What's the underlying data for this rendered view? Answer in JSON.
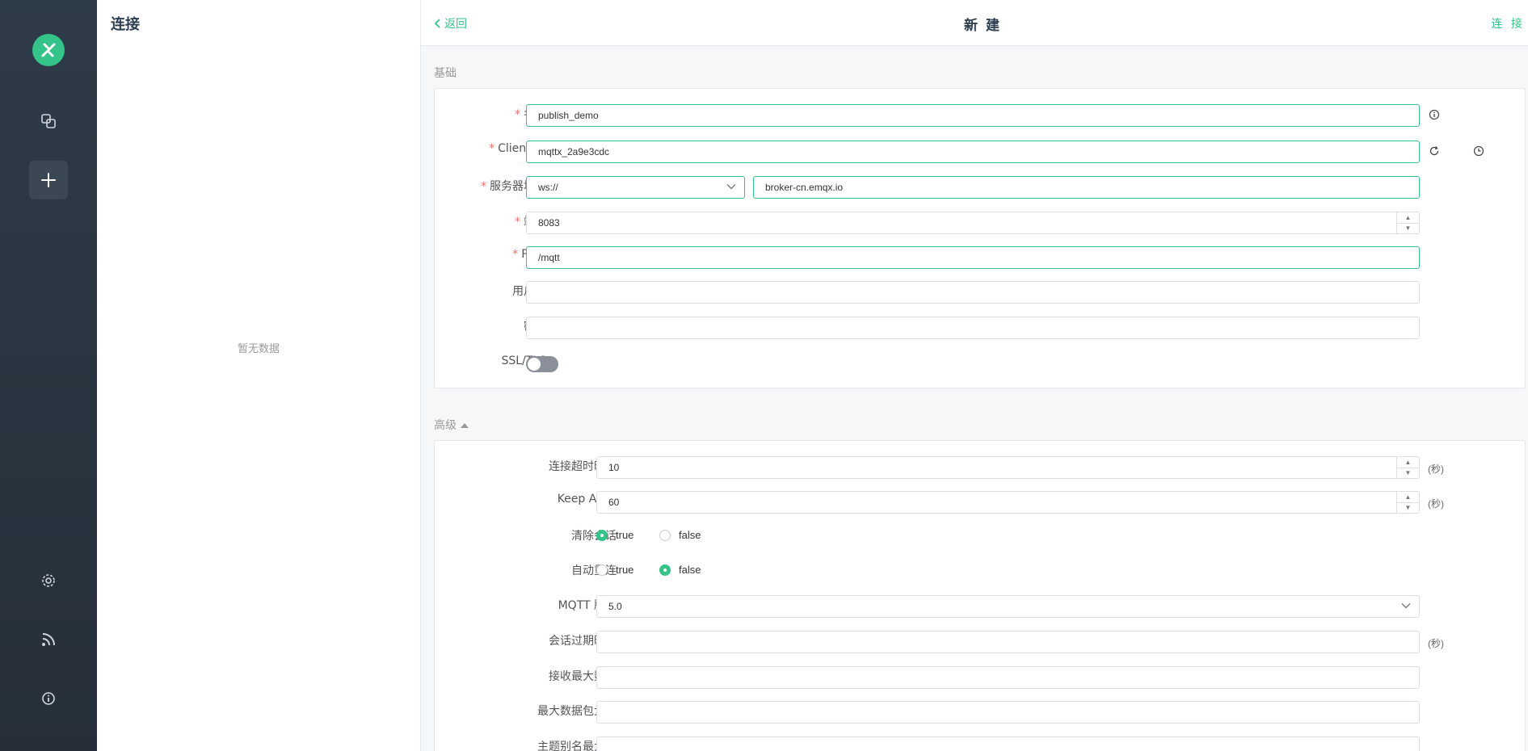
{
  "nav": {
    "logo_icon": "mqttx-logo",
    "items": [
      {
        "name": "connections-icon"
      },
      {
        "name": "new-connection-icon"
      },
      {
        "name": "settings-icon"
      },
      {
        "name": "feed-icon"
      },
      {
        "name": "about-icon"
      }
    ],
    "accent": "#34c388"
  },
  "list": {
    "title": "连接",
    "empty_text": "暂无数据"
  },
  "header": {
    "back_label": "返回",
    "title": "新 建",
    "connect_label": "连 接"
  },
  "basic": {
    "section_label": "基础",
    "name_label": "名称",
    "name_value": "publish_demo",
    "client_id_label": "Client ID",
    "client_id_value": "mqttx_2a9e3cdc",
    "host_label": "服务器地址",
    "protocol_value": "ws://",
    "host_value": "broker-cn.emqx.io",
    "port_label": "端口",
    "port_value": "8083",
    "path_label": "Path",
    "path_value": "/mqtt",
    "username_label": "用户名",
    "username_value": "",
    "password_label": "密码",
    "password_value": "",
    "ssl_label": "SSL/TLS",
    "ssl_enabled": false
  },
  "advanced": {
    "section_label": "高级",
    "timeout_label": "连接超时时长",
    "timeout_value": "10",
    "timeout_unit": "(秒)",
    "keepalive_label": "Keep Alive",
    "keepalive_value": "60",
    "keepalive_unit": "(秒)",
    "clean_label": "清除会话",
    "clean_value": "true",
    "reconnect_label": "自动重连",
    "reconnect_value": "false",
    "true_label": "true",
    "false_label": "false",
    "mqtt_version_label": "MQTT 版本",
    "mqtt_version_value": "5.0",
    "session_expiry_label": "会话过期时间",
    "session_expiry_unit": "(秒)",
    "receive_max_label": "接收最大数值",
    "max_packet_label": "最大数据包大小",
    "topic_alias_label": "主题别名最大值"
  }
}
